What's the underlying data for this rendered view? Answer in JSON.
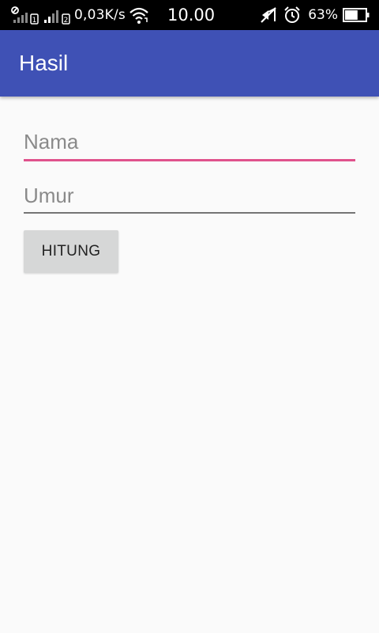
{
  "status_bar": {
    "network_speed": "0,03K/s",
    "time": "10.00",
    "battery_percent": "63%",
    "sim1_label": "1",
    "sim2_label": "2",
    "battery_level": 0.63
  },
  "app_bar": {
    "title": "Hasil",
    "color": "#3f51b5"
  },
  "form": {
    "nama": {
      "placeholder": "Nama",
      "value": ""
    },
    "umur": {
      "placeholder": "Umur",
      "value": ""
    },
    "submit_label": "HITUNG"
  },
  "colors": {
    "accent": "#e0528c",
    "primary": "#3f51b5",
    "button_bg": "#d6d7d7",
    "background": "#fafafa"
  },
  "icons": [
    "no-data-icon",
    "signal-sim1-icon",
    "signal-sim2-icon",
    "wifi-icon",
    "mute-icon",
    "alarm-icon",
    "battery-icon"
  ]
}
